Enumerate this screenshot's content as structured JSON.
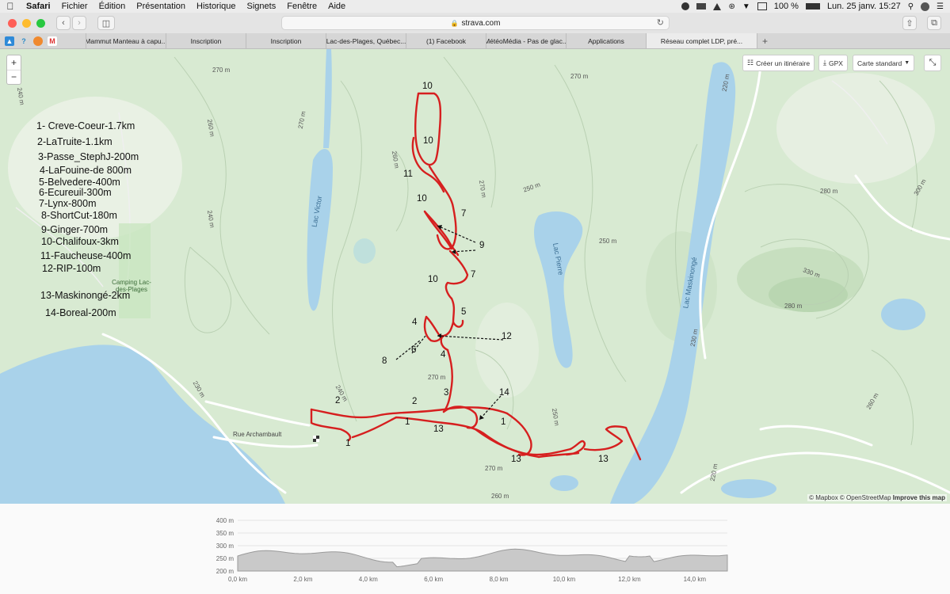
{
  "menubar": {
    "app": "Safari",
    "items": [
      "Fichier",
      "Édition",
      "Présentation",
      "Historique",
      "Signets",
      "Fenêtre",
      "Aide"
    ],
    "battery": "100 %",
    "datetime": "Lun. 25 janv.  15:27"
  },
  "browser": {
    "url": "strava.com",
    "tabs": [
      "Mammut Manteau à capu...",
      "Inscription",
      "Inscription",
      "Lac-des-Plages, Québec...",
      "(1) Facebook",
      "MétéoMédia - Pas de glac...",
      "Applications",
      "Réseau complet LDP, pré..."
    ],
    "active_tab": 7,
    "colors": {
      "chrome": "#e4e4e4",
      "tabbar": "#d6d6d6"
    }
  },
  "map": {
    "controls": {
      "zoom_in": "+",
      "zoom_out": "−",
      "create_route": "Créer un itinéraire",
      "gpx": "GPX",
      "map_style": "Carte standard"
    },
    "attribution": {
      "mapbox": "© Mapbox",
      "osm": "© OpenStreetMap",
      "improve": "Improve this map"
    },
    "place_labels": {
      "lac_victor": "Lac Victor",
      "lac_pierre": "Lac Pierre",
      "lac_maskinonge": "Lac Maskinongé",
      "camping": "Camping Lac-des-Plages",
      "rue_archambault": "Rue Archambault"
    },
    "contours": [
      "270 m",
      "260 m",
      "250 m",
      "240 m",
      "230 m",
      "220 m",
      "280 m",
      "300 m",
      "330 m"
    ],
    "route_color": "#d61f1f",
    "water_color": "#a9d2ea",
    "legend": [
      "1- Creve-Coeur-1.7km",
      "2-LaTruite-1.1km",
      "3-Passe_StephJ-200m",
      "4-LaFouine-de 800m",
      "5-Belvedere-400m",
      "6-Ecureuil-300m",
      "7-Lynx-800m",
      "8-ShortCut-180m",
      "9-Ginger-700m",
      "10-Chalifoux-3km",
      "11-Faucheuse-400m",
      "12-RIP-100m",
      "13-Maskinongé-2km",
      "14-Boreal-200m"
    ],
    "trail_numbers": [
      "10",
      "10",
      "11",
      "10",
      "7",
      "9",
      "10",
      "7",
      "5",
      "4",
      "6",
      "12",
      "8",
      "4",
      "3",
      "14",
      "2",
      "2",
      "1",
      "13",
      "1",
      "1",
      "13",
      "13"
    ]
  },
  "elevation": {
    "y_ticks": [
      "400 m",
      "350 m",
      "300 m",
      "250 m",
      "200 m"
    ],
    "x_ticks": [
      "0,0 km",
      "2,0 km",
      "4,0 km",
      "6,0 km",
      "8,0 km",
      "10,0 km",
      "12,0 km",
      "14,0 km"
    ],
    "profile_color": "#c8c8c8"
  }
}
